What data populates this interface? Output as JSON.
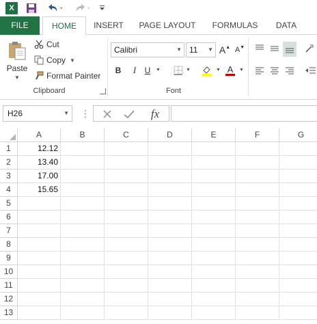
{
  "qat": {
    "logo_text": "X",
    "icons": [
      "excel-logo-icon",
      "save-icon",
      "undo-icon",
      "redo-icon",
      "customize-toolbar-icon"
    ]
  },
  "tabs": [
    {
      "label": "FILE",
      "active": false
    },
    {
      "label": "HOME",
      "active": true
    },
    {
      "label": "INSERT",
      "active": false
    },
    {
      "label": "PAGE LAYOUT",
      "active": false
    },
    {
      "label": "FORMULAS",
      "active": false
    },
    {
      "label": "DATA",
      "active": false
    }
  ],
  "ribbon": {
    "clipboard": {
      "paste_label": "Paste",
      "cut_label": "Cut",
      "copy_label": "Copy",
      "format_painter_label": "Format Painter",
      "group_label": "Clipboard"
    },
    "font": {
      "font_name": "Calibri",
      "font_size": "11",
      "bold_label": "B",
      "italic_label": "I",
      "underline_label": "U",
      "grow_label": "A",
      "shrink_label": "A",
      "font_color_label": "A",
      "group_label": "Font",
      "fill_color": "#ffff00",
      "font_color": "#c00000"
    }
  },
  "formula_bar": {
    "name_box": "H26",
    "fx_label": "fx",
    "formula": ""
  },
  "sheet": {
    "columns": [
      "A",
      "B",
      "C",
      "D",
      "E",
      "F",
      "G"
    ],
    "rows": [
      "1",
      "2",
      "3",
      "4",
      "5",
      "6",
      "7",
      "8",
      "9",
      "10",
      "11",
      "12",
      "13"
    ],
    "cells": {
      "A1": "12.12",
      "A2": "13.40",
      "A3": "17.00",
      "A4": "15.65"
    }
  },
  "colors": {
    "accent": "#217346",
    "file_tab": "#217346"
  }
}
